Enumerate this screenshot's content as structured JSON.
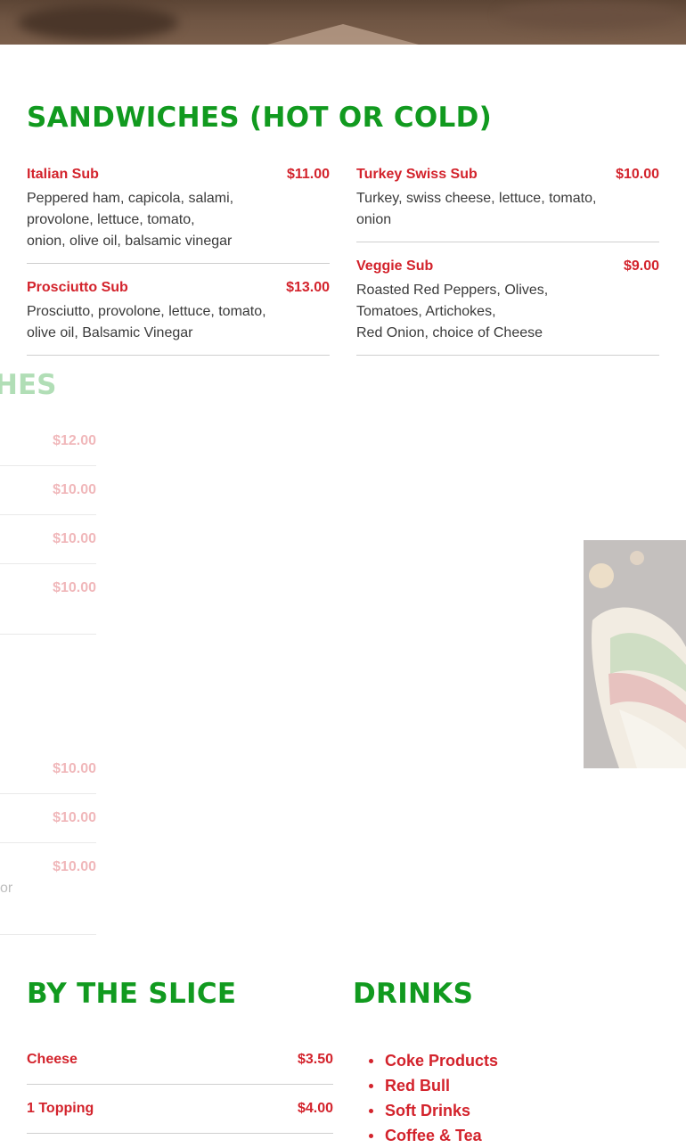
{
  "colors": {
    "title_green": "#119a1f",
    "accent_red": "#d3232c",
    "body_text": "#3a3a3a"
  },
  "sandwiches": {
    "title": "SANDWICHES (HOT OR COLD)",
    "items": [
      {
        "name": "Italian Sub",
        "price": "$11.00",
        "desc": [
          "Peppered ham, capicola, salami,",
          "provolone, lettuce, tomato,",
          "onion, olive oil, balsamic vinegar"
        ]
      },
      {
        "name": "Turkey Swiss Sub",
        "price": "$10.00",
        "desc": [
          "Turkey, swiss cheese, lettuce, tomato,",
          "onion"
        ]
      },
      {
        "name": "Prosciutto Sub",
        "price": "$13.00",
        "desc": [
          "Prosciutto, provolone, lettuce, tomato,",
          "olive oil, Balsamic Vinegar"
        ]
      },
      {
        "name": "Veggie Sub",
        "price": "$9.00",
        "desc": [
          "Roasted Red Peppers, Olives,",
          "Tomatoes, Artichokes,",
          "Red Onion, choice of Cheese"
        ]
      }
    ]
  },
  "faded_section": {
    "title_fragment": "HES",
    "prices": [
      "$12.00",
      "$10.00",
      "$10.00",
      "$10.00",
      "$10.00",
      "$10.00",
      "$10.00"
    ],
    "desc_fragment": "or"
  },
  "by_the_slice": {
    "title": "BY THE SLICE",
    "items": [
      {
        "name": "Cheese",
        "price": "$3.50"
      },
      {
        "name": "1 Topping",
        "price": "$4.00"
      }
    ]
  },
  "drinks": {
    "title": "DRINKS",
    "items": [
      "Coke Products",
      "Red Bull",
      "Soft Drinks",
      "Coffee & Tea"
    ]
  }
}
